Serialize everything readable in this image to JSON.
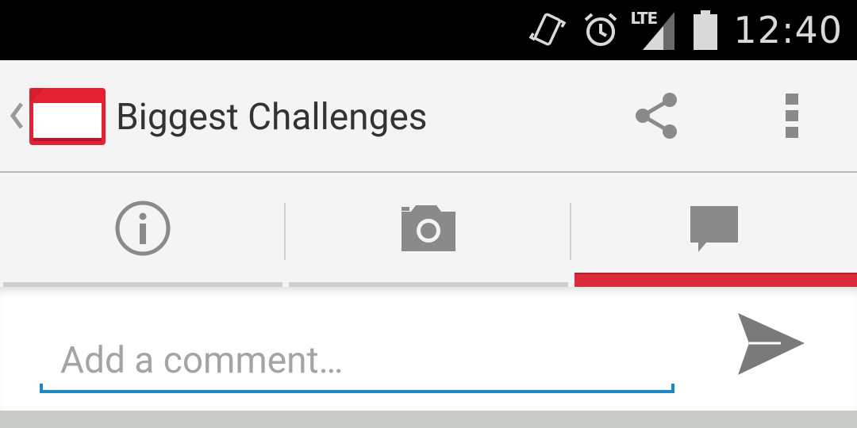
{
  "status_bar": {
    "time": "12:40",
    "network_type": "LTE",
    "icons": [
      "vibrate-icon",
      "alarm-icon",
      "signal-icon",
      "battery-icon"
    ]
  },
  "action_bar": {
    "title": "Biggest Challenges",
    "icons": [
      "up-chevron-icon",
      "app-icon",
      "share-icon",
      "overflow-menu-icon"
    ]
  },
  "tabs": [
    {
      "icon": "info-icon",
      "selected": false
    },
    {
      "icon": "camera-icon",
      "selected": false
    },
    {
      "icon": "comment-icon",
      "selected": true
    }
  ],
  "composer": {
    "placeholder": "Add a comment…",
    "value": "",
    "send_icon": "send-icon"
  },
  "colors": {
    "accent": "#d92b3a",
    "input_underline": "#1e88c7",
    "status_bar_bg": "#000000",
    "action_bar_bg": "#f4f4f4"
  }
}
